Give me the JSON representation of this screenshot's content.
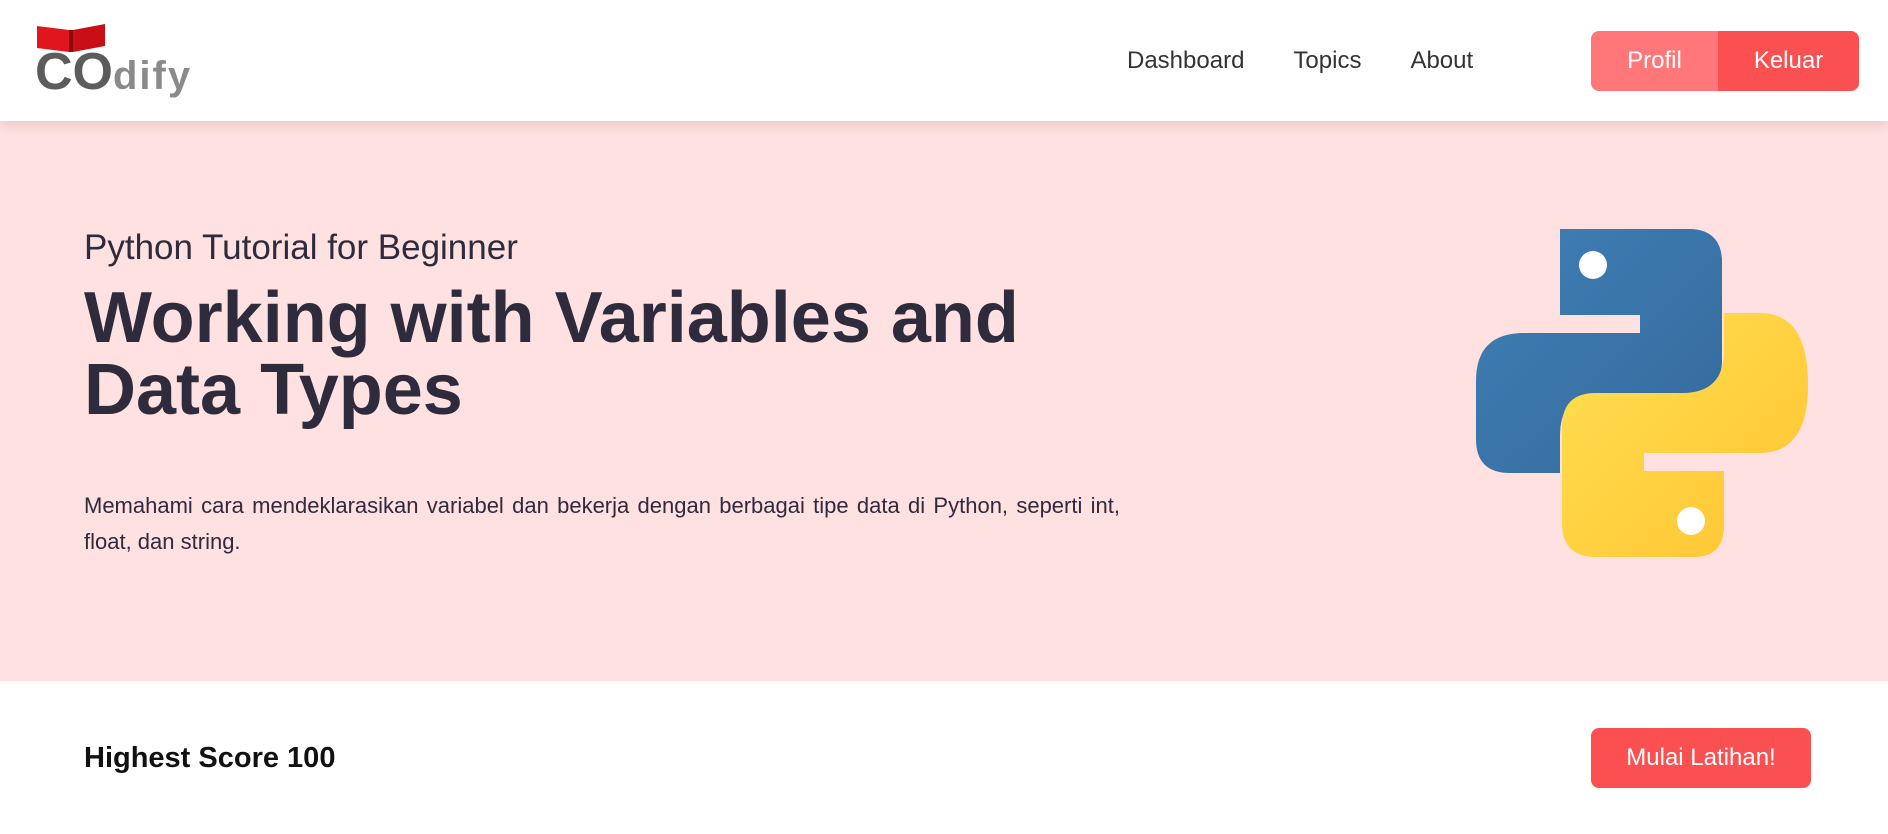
{
  "brand": {
    "logo_text_big": "CO",
    "logo_text_small": "dify",
    "logo_icon": "open-book-icon",
    "colors": {
      "book_red": "#d9141a",
      "text_gray": "#6b6b6b"
    }
  },
  "nav": {
    "links": [
      "Dashboard",
      "Topics",
      "About"
    ],
    "profil_label": "Profil",
    "keluar_label": "Keluar"
  },
  "hero": {
    "subtitle": "Python Tutorial for Beginner",
    "title_line1": "Working with Variables and",
    "title_line2": "Data Types",
    "description": "Memahami cara mendeklarasikan variabel dan bekerja dengan berbagai tipe data di Python, seperti int, float, dan string.",
    "image_icon": "python-logo-icon",
    "background": "#ffe1e1"
  },
  "score": {
    "text": "Highest Score 100",
    "button_label": "Mulai Latihan!"
  },
  "colors": {
    "accent_red": "#fa5052",
    "accent_light_red": "#ff7779",
    "heading_dark": "#2e2b3c",
    "python_blue": "#3776ab",
    "python_yellow": "#ffd43b"
  }
}
